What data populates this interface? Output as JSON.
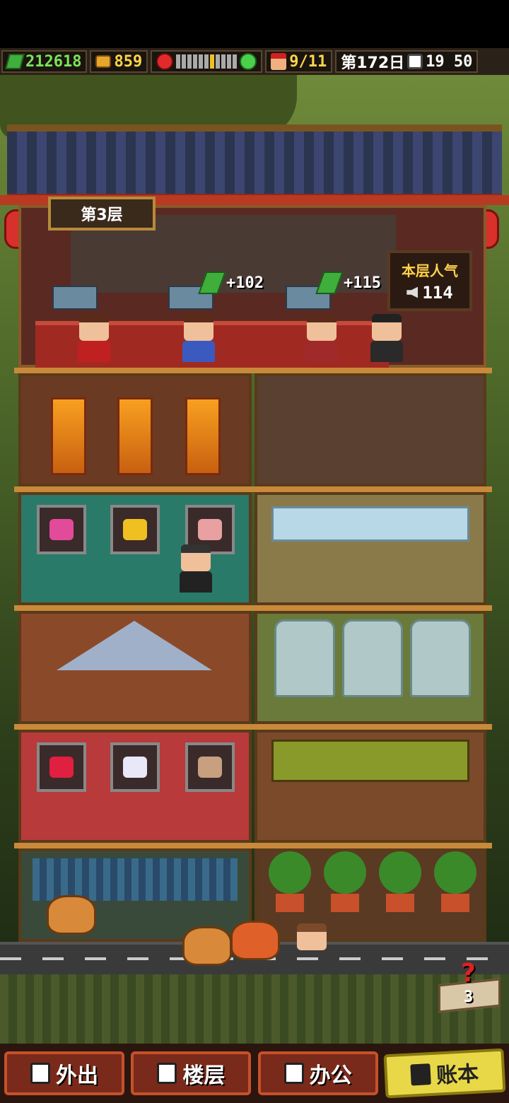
{
  "status_bar": {
    "money": "212618",
    "coins": "859",
    "workers": "9/11",
    "day": "第172日",
    "time": "19 50",
    "mood_level": 0.55
  },
  "floor": {
    "label": "第3层",
    "popularity_label": "本层人气",
    "popularity_value": "114",
    "earnings": [
      "+102",
      "+115"
    ]
  },
  "help": {
    "count": "3"
  },
  "nav": {
    "items": [
      {
        "label": "外出",
        "icon": "door-exit-icon"
      },
      {
        "label": "楼层",
        "icon": "floors-icon"
      },
      {
        "label": "办公",
        "icon": "office-icon"
      },
      {
        "label": "账本",
        "icon": "ledger-icon"
      }
    ],
    "active": "账本"
  },
  "colors": {
    "money_text": "#7be35a",
    "coin_text": "#ffd54a",
    "popularity_text": "#ffd24a",
    "active_nav": "#e8d848"
  }
}
